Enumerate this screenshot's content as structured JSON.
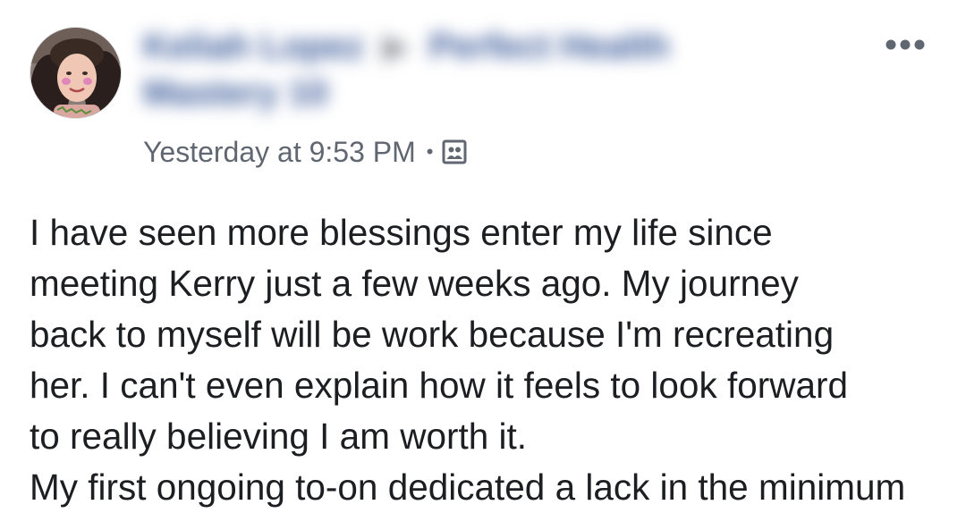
{
  "post": {
    "author": "Keliah Lopez",
    "arrow": "▶",
    "group": "Perfect Health Mastery 10",
    "timestamp": "Yesterday at 9:53 PM",
    "separator": "•",
    "privacy_icon": "group-members-icon",
    "more_icon": "more-options-icon",
    "more_label": "•••",
    "body_lines": [
      "I have seen more blessings enter my life since",
      "meeting Kerry just a few weeks ago. My journey",
      "back to myself will be work because I'm recreating",
      "her. I can't even explain how it feels to look forward",
      "to really believing I am worth it.",
      "My first ongoing to-on dedicated a lack in the minimum"
    ]
  },
  "colors": {
    "name_link": "#385898",
    "meta_text": "#606770",
    "body_text": "#1c1e21",
    "icon_grey": "#606770"
  }
}
